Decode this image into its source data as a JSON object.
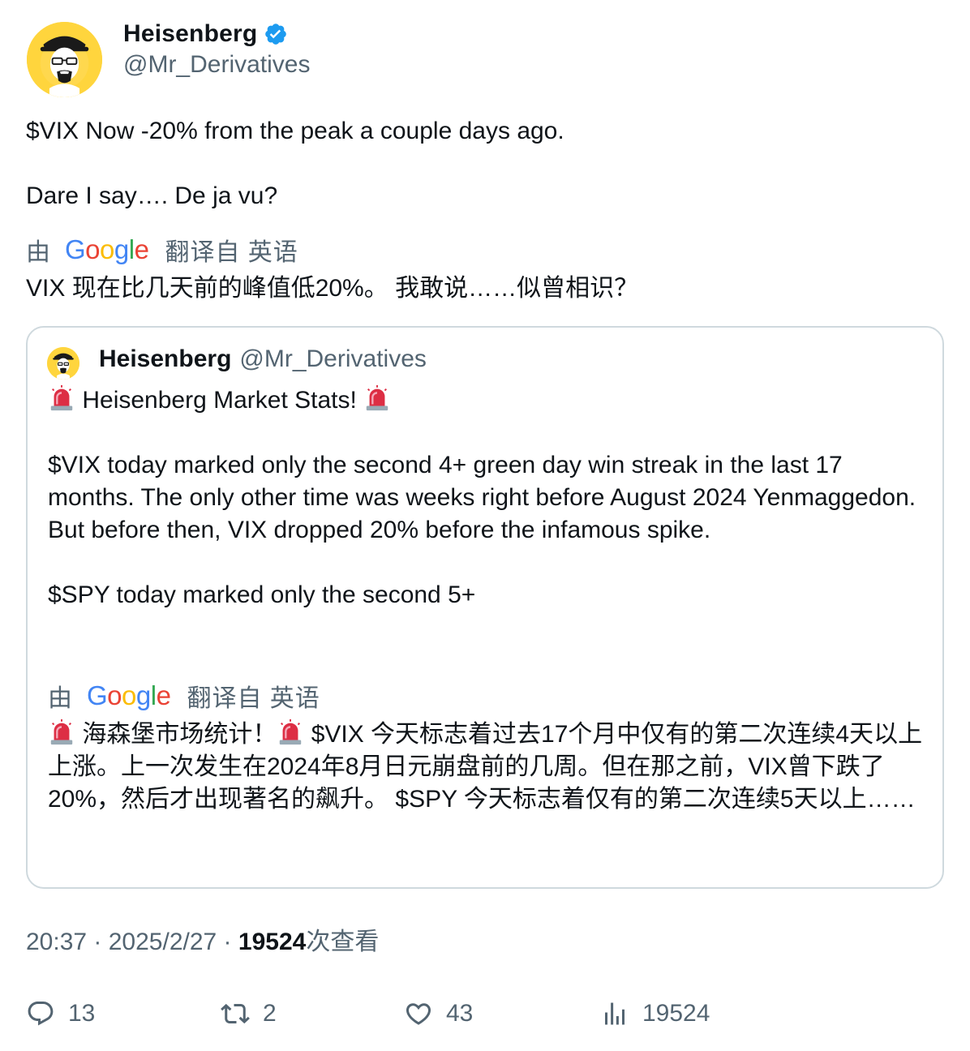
{
  "author": {
    "display_name": "Heisenberg",
    "handle": "@Mr_Derivatives",
    "verified": true
  },
  "tweet": {
    "lines": [
      "$VIX Now -20% from the peak a couple days ago.",
      "Dare I say…. De ja vu?"
    ],
    "translate": {
      "by": "由",
      "google": "Google",
      "from": "翻译自 英语"
    },
    "translated_text": "VIX 现在比几天前的峰值低20%。 我敢说……似曾相识？"
  },
  "quote": {
    "display_name": "Heisenberg",
    "handle": "@Mr_Derivatives",
    "title": "Heisenberg Market Stats!",
    "paragraph1": "$VIX today marked only the second 4+ green day win streak in the last 17 months. The only other time was weeks right before August 2024 Yenmaggedon. But before then, VIX dropped 20% before the infamous spike.",
    "paragraph2": "$SPY today marked only the second 5+",
    "translate": {
      "by": "由",
      "google": "Google",
      "from": "翻译自 英语"
    },
    "translated_title": "海森堡市场统计！",
    "translated_rest": "$VIX 今天标志着过去17个月中仅有的第二次连续4天以上上涨。上一次发生在2024年8月日元崩盘前的几周。但在那之前，VIX曾下跌了20%，然后才出现著名的飙升。 $SPY 今天标志着仅有的第二次连续5天以上……"
  },
  "meta": {
    "time": "20:37",
    "sep1": " · ",
    "date": "2025/2/27",
    "sep2": " · ",
    "views_count": "19524",
    "views_label": "次查看"
  },
  "actions": {
    "replies": "13",
    "retweets": "2",
    "likes": "43",
    "views": "19524"
  },
  "colors": {
    "text_primary": "#0f1419",
    "text_secondary": "#536471",
    "verified": "#1d9bf0",
    "border": "#cfd9de",
    "google_blue": "#4285F4",
    "google_red": "#EA4335",
    "google_yellow": "#FBBC05",
    "google_green": "#34A853"
  },
  "icons": {
    "verified": "verified-badge-icon",
    "siren": "police-siren-emoji",
    "reply": "reply-icon",
    "retweet": "retweet-icon",
    "like": "heart-icon",
    "views": "bar-chart-icon"
  }
}
